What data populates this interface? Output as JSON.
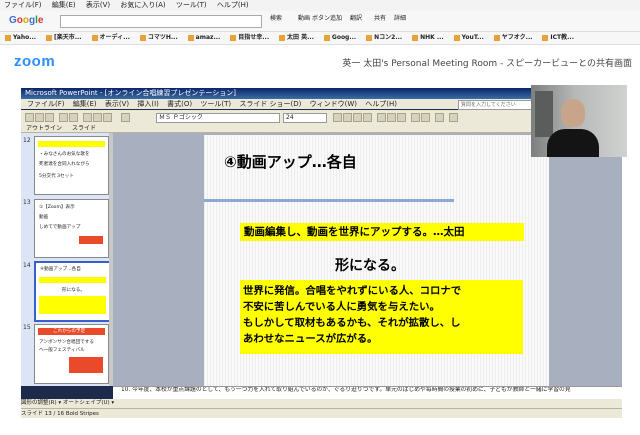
{
  "browser": {
    "menu": [
      "ファイル(F)",
      "編集(E)",
      "表示(V)",
      "お気に入り(A)",
      "ツール(T)",
      "ヘルプ(H)"
    ],
    "toolbar": {
      "google_logo": "Google",
      "search_label": "検索",
      "buttons": [
        "動画",
        "ボタン追加",
        "翻訳",
        "共有",
        "詳細"
      ]
    },
    "favorites": [
      "Yaho...",
      "[楽天市...",
      "オーディ...",
      "コマツH...",
      "amaz...",
      "目指せ幸...",
      "太田 英...",
      "Goog...",
      "Nコン2...",
      "NHK ...",
      "YouT...",
      "ヤフオク...",
      "ICT教..."
    ]
  },
  "zoom": {
    "logo": "zoom",
    "meeting_title": "英一 太田's Personal Meeting Room - スピーカービューとの共有画面"
  },
  "powerpoint": {
    "title": "Microsoft PowerPoint - [オンライン合唱練習プレゼンテーション]",
    "menu": [
      "ファイル(F)",
      "編集(E)",
      "表示(V)",
      "挿入(I)",
      "書式(O)",
      "ツール(T)",
      "スライド ショー(D)",
      "ウィンドウ(W)",
      "ヘルプ(H)"
    ],
    "help_placeholder": "質問を入力してください",
    "font_name": "ＭＳ Ｐゴシック",
    "font_size": "24",
    "panel_tabs": [
      "アウトライン",
      "スライド"
    ],
    "thumbnails": [
      {
        "num": "12",
        "lines": [
          "・みなさんのお気な歌を",
          "死者達を合同入れながら",
          "5分交代 3セット"
        ]
      },
      {
        "num": "13",
        "lines": [
          "①【Zoom】表示",
          "動画",
          "しめてで動画アップ"
        ]
      },
      {
        "num": "14",
        "lines": [
          "④動画アップ…各自",
          "形になる。"
        ]
      },
      {
        "num": "15",
        "lines": [
          "これからの予定",
          "アンボンサン合唱団でする",
          "ヘ一般フェスティバル"
        ]
      }
    ],
    "slide": {
      "title": "④動画アップ…各自",
      "line1": "動画編集し、動画を世界にアップする。…太田",
      "line2": "形になる。",
      "box_lines": [
        "世界に発信。合唱をやれずにいる人、コロナで",
        "不安に苦しんでいる人に勇気を与えたい。",
        "もしかして取材もあるかも、それが拡散し、し",
        "あわせなニュースが広がる。"
      ]
    },
    "notes": "10. 今年度、本校が重点課題のとして、もう一つ力を入れて取り組んでいるのが、ぐるり迫りつです。単元のはじめや毎時間の授業の初めに、子どもが教師と一緒に学習の見",
    "draw_toolbar": "図形の調整(R) ▾  オートシェイプ(U) ▾",
    "status": "スライド 13 / 16        Bold Stripes"
  }
}
